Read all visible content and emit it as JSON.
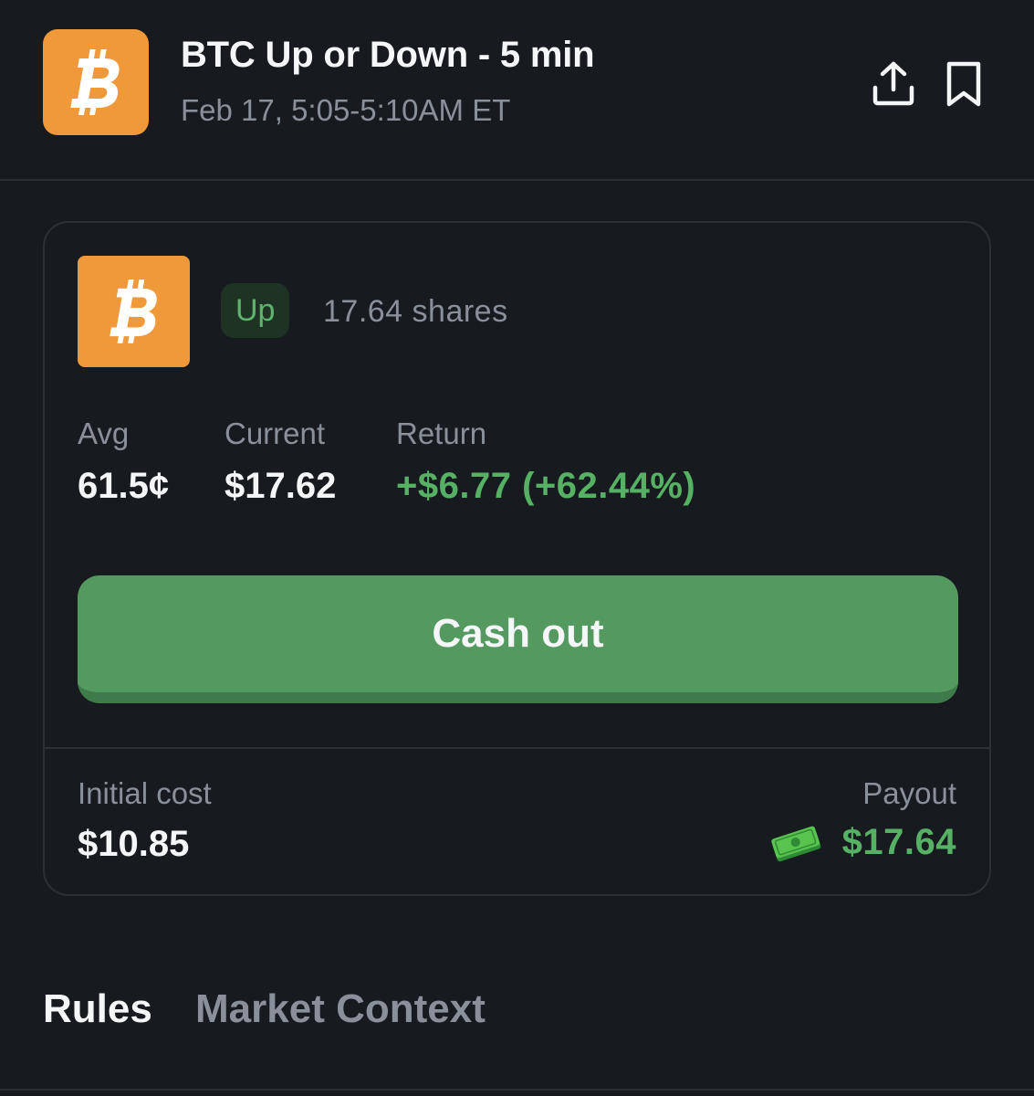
{
  "header": {
    "title": "BTC Up or Down - 5 min",
    "subtitle": "Feb 17, 5:05-5:10AM ET",
    "logo_icon": "bitcoin-icon",
    "actions": [
      "share-icon",
      "bookmark-icon"
    ]
  },
  "position": {
    "side": "Up",
    "shares": "17.64 shares",
    "stats": {
      "avg_label": "Avg",
      "avg_value": "61.5¢",
      "current_label": "Current",
      "current_value": "$17.62",
      "return_label": "Return",
      "return_value": "+$6.77 (+62.44%)"
    },
    "cashout_label": "Cash out",
    "initial_cost_label": "Initial cost",
    "initial_cost_value": "$10.85",
    "payout_label": "Payout",
    "payout_value": "$17.64",
    "payout_icon": "money-icon"
  },
  "tabs": {
    "rules": "Rules",
    "market_context": "Market Context"
  },
  "colors": {
    "background": "#171a1f",
    "bitcoin_orange": "#f0993a",
    "positive_green": "#57b165",
    "button_green": "#549a60",
    "muted_text": "#8a909a"
  }
}
